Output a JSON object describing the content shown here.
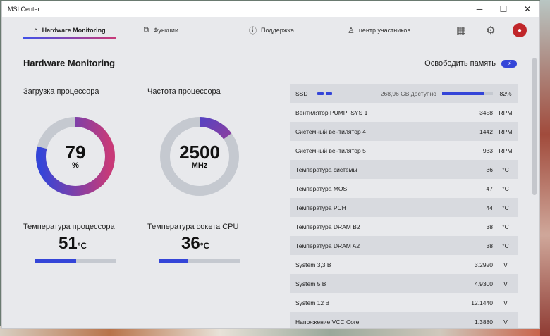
{
  "window": {
    "title": "MSI Center"
  },
  "nav": {
    "tabs": [
      {
        "label": "Hardware Monitoring",
        "icon": "gauge-icon"
      },
      {
        "label": "Функции",
        "icon": "external-icon"
      },
      {
        "label": "Поддержка",
        "icon": "alert-icon"
      },
      {
        "label": "центр участников",
        "icon": "user-icon"
      }
    ]
  },
  "page": {
    "title": "Hardware Monitoring",
    "free_memory_label": "Освободить память"
  },
  "cpu_load": {
    "label": "Загрузка процессора",
    "value": "79",
    "unit": "%",
    "fraction": 0.79
  },
  "cpu_freq": {
    "label": "Частота процессора",
    "value": "2500",
    "unit": "MHz",
    "fraction": 0.15
  },
  "cpu_temp": {
    "label": "Температура процессора",
    "value": "51",
    "unit": "°C",
    "fraction": 0.51
  },
  "socket_temp": {
    "label": "Температура сокета CPU",
    "value": "36",
    "unit": "°C",
    "fraction": 0.36
  },
  "ssd": {
    "label": "SSD",
    "available": "268,96 GB доступно",
    "percent": "82%",
    "fraction": 0.82
  },
  "sensors": [
    {
      "name": "Вентилятор PUMP_SYS 1",
      "value": "3458",
      "unit": "RPM"
    },
    {
      "name": "Системный вентилятор 4",
      "value": "1442",
      "unit": "RPM"
    },
    {
      "name": "Системный вентилятор 5",
      "value": "933",
      "unit": "RPM"
    },
    {
      "name": "Температура системы",
      "value": "36",
      "unit": "°C"
    },
    {
      "name": "Температура MOS",
      "value": "47",
      "unit": "°C"
    },
    {
      "name": "Температура PCH",
      "value": "44",
      "unit": "°C"
    },
    {
      "name": "Температура DRAM B2",
      "value": "38",
      "unit": "°C"
    },
    {
      "name": "Температура DRAM A2",
      "value": "38",
      "unit": "°C"
    },
    {
      "name": "System 3,3 В",
      "value": "3.2920",
      "unit": "V"
    },
    {
      "name": "System 5 В",
      "value": "4.9300",
      "unit": "V"
    },
    {
      "name": "System 12 В",
      "value": "12.1440",
      "unit": "V"
    },
    {
      "name": "Напряжение VCC Core",
      "value": "1.3880",
      "unit": "V"
    }
  ],
  "colors": {
    "accent": "#3445d8",
    "gradient_end": "#c83a78",
    "track": "#c5c9d0"
  }
}
